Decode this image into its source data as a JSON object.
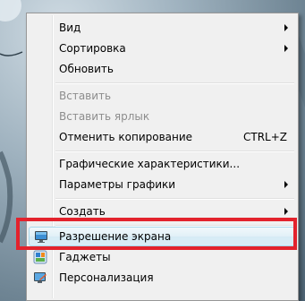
{
  "context_menu": {
    "items": [
      {
        "label": "Вид",
        "submenu": true,
        "disabled": false
      },
      {
        "label": "Сортировка",
        "submenu": true,
        "disabled": false
      },
      {
        "label": "Обновить",
        "submenu": false,
        "disabled": false
      },
      {
        "label": "Вставить",
        "submenu": false,
        "disabled": true
      },
      {
        "label": "Вставить ярлык",
        "submenu": false,
        "disabled": true
      },
      {
        "label": "Отменить копирование",
        "shortcut": "CTRL+Z",
        "submenu": false,
        "disabled": false
      },
      {
        "label": "Графические характеристики...",
        "submenu": false,
        "disabled": false
      },
      {
        "label": "Параметры графики",
        "submenu": true,
        "disabled": false
      },
      {
        "label": "Создать",
        "submenu": true,
        "disabled": false
      },
      {
        "label": "Разрешение экрана",
        "icon": "display-icon",
        "highlighted": true
      },
      {
        "label": "Гаджеты",
        "icon": "gadgets-icon"
      },
      {
        "label": "Персонализация",
        "icon": "personalization-icon"
      }
    ]
  },
  "colors": {
    "highlight_box": "#e3222c",
    "menu_background": "#f0f0f0"
  }
}
